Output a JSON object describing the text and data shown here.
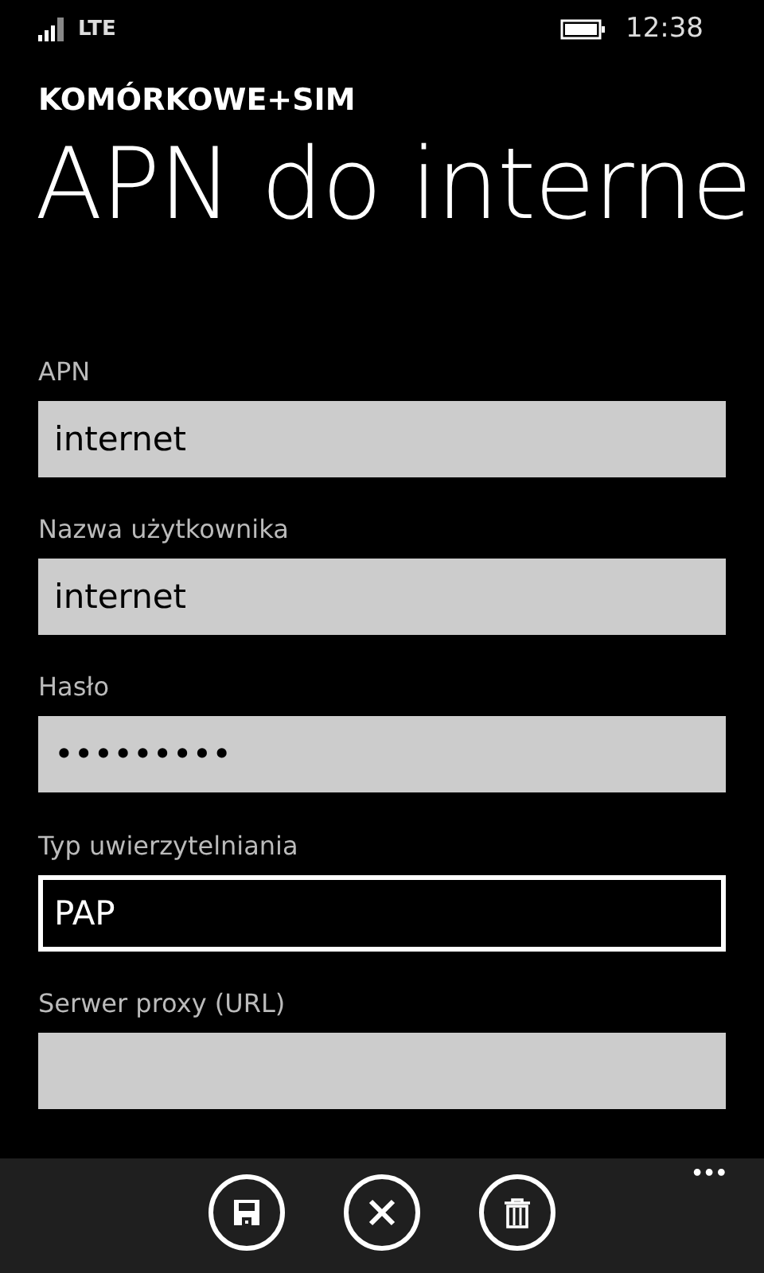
{
  "status_bar": {
    "network": "LTE",
    "time": "12:38"
  },
  "header": {
    "section": "KOMÓRKOWE+SIM",
    "title": "APN do interne"
  },
  "fields": [
    {
      "label": "APN",
      "value": "internet",
      "focused": false
    },
    {
      "label": "Nazwa użytkownika",
      "value": "internet",
      "focused": false
    },
    {
      "label": "Hasło",
      "value": "•••••••••",
      "focused": false
    },
    {
      "label": "Typ uwierzytelniania",
      "value": "PAP",
      "focused": true
    },
    {
      "label": "Serwer proxy (URL)",
      "focused": false
    }
  ],
  "app_bar": {
    "buttons": [
      {
        "kind": "save"
      },
      {
        "kind": "cancel"
      },
      {
        "kind": "delete"
      }
    ],
    "more": "•••"
  }
}
